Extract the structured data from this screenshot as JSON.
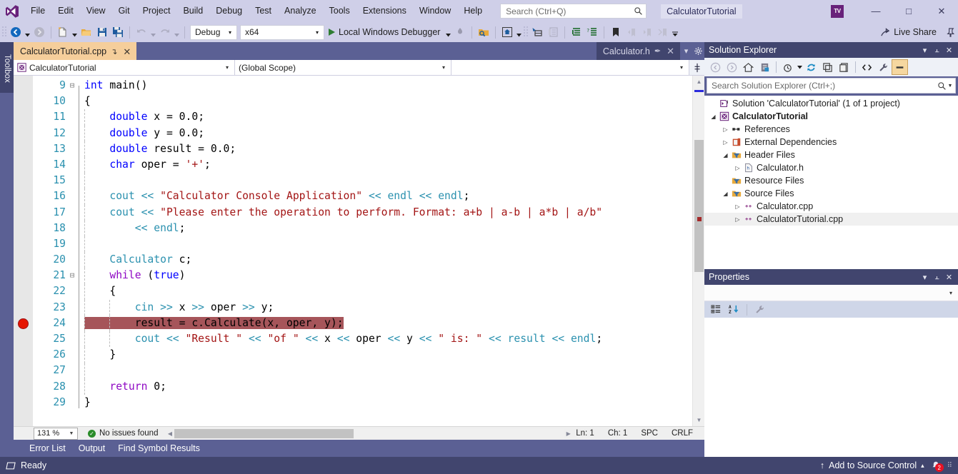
{
  "window": {
    "logo_icon": "visual-studio-logo",
    "project_chip": "CalculatorTutorial",
    "account_badge": "TV",
    "minimize": "—",
    "maximize": "□",
    "close": "✕"
  },
  "menu": {
    "items": [
      {
        "label": "File"
      },
      {
        "label": "Edit"
      },
      {
        "label": "View"
      },
      {
        "label": "Git"
      },
      {
        "label": "Project"
      },
      {
        "label": "Build"
      },
      {
        "label": "Debug"
      },
      {
        "label": "Test"
      },
      {
        "label": "Analyze"
      },
      {
        "label": "Tools"
      },
      {
        "label": "Extensions"
      },
      {
        "label": "Window"
      },
      {
        "label": "Help"
      }
    ]
  },
  "search": {
    "placeholder": "Search (Ctrl+Q)",
    "value": "",
    "icon": "search-icon"
  },
  "toolbar": {
    "navigate_back_icon": "navigate-back-icon",
    "navigate_forward_icon": "navigate-forward-icon",
    "new_item_icon": "new-item-icon",
    "open_file_icon": "open-file-icon",
    "save_icon": "save-icon",
    "save_all_icon": "save-all-icon",
    "undo_icon": "undo-icon",
    "redo_icon": "redo-icon",
    "config_combo": {
      "value": "Debug",
      "arrow": "▾"
    },
    "platform_combo": {
      "value": "x64",
      "arrow": "▾"
    },
    "run_label": "Local Windows Debugger",
    "run_arrow": "▾",
    "attach_icon": "attach-process-icon",
    "find_in_files_icon": "find-in-files-icon",
    "solution_explorer_icon": "solution-explorer-icon",
    "properties_window_icon": "properties-window-icon",
    "object_browser_icon": "object-browser-icon",
    "comment_icon": "comment-selection-icon",
    "uncomment_icon": "uncomment-selection-icon",
    "bookmark_icon": "bookmark-icon",
    "prev_bookmark_icon": "previous-bookmark-icon",
    "next_bookmark_icon": "next-bookmark-icon",
    "clear_bookmarks_icon": "clear-bookmarks-icon",
    "overflow_icon": "toolbar-overflow-icon",
    "live_share_label": "Live Share",
    "live_share_icon": "live-share-icon",
    "pin_icon": "pin-icon"
  },
  "toolbox": {
    "label": "Toolbox"
  },
  "editor": {
    "tabs": [
      {
        "label": "CalculatorTutorial.cpp",
        "active": true,
        "pin": "↴",
        "close": "✕"
      },
      {
        "label": "Calculator.h",
        "active": false,
        "pin": "✒",
        "close": "✕"
      }
    ],
    "tab_overflow_icon": "tab-overflow-icon",
    "tab_settings_icon": "tab-settings-icon",
    "nav_project": "CalculatorTutorial",
    "nav_project_icon": "cpp-project-icon",
    "nav_scope": "(Global Scope)",
    "nav_member": "",
    "split_icon": "split-view-icon",
    "zoom_level": "131 %",
    "issues_text": "No issues found",
    "issues_icon": "ok-check-icon",
    "line_status": "Ln: 1",
    "char_status": "Ch: 1",
    "spaces_status": "SPC",
    "eol_status": "CRLF",
    "breakpoint_line": 24,
    "code_lines": [
      {
        "n": 9,
        "glyph": "⊟",
        "tokens": [
          {
            "t": "int ",
            "c": "kw"
          },
          {
            "t": "main",
            "c": "op"
          },
          {
            "t": "()",
            "c": "op"
          }
        ],
        "indent": 0
      },
      {
        "n": 10,
        "glyph": "",
        "tokens": [
          {
            "t": "{",
            "c": "op"
          }
        ],
        "indent": 0
      },
      {
        "n": 11,
        "glyph": "",
        "tokens": [
          {
            "t": "    ",
            "c": "op"
          },
          {
            "t": "double",
            "c": "kw"
          },
          {
            "t": " x = ",
            "c": "op"
          },
          {
            "t": "0.0",
            "c": "op"
          },
          {
            "t": ";",
            "c": "op"
          }
        ],
        "indent": 1
      },
      {
        "n": 12,
        "glyph": "",
        "tokens": [
          {
            "t": "    ",
            "c": "op"
          },
          {
            "t": "double",
            "c": "kw"
          },
          {
            "t": " y = ",
            "c": "op"
          },
          {
            "t": "0.0",
            "c": "op"
          },
          {
            "t": ";",
            "c": "op"
          }
        ],
        "indent": 1
      },
      {
        "n": 13,
        "glyph": "",
        "tokens": [
          {
            "t": "    ",
            "c": "op"
          },
          {
            "t": "double",
            "c": "kw"
          },
          {
            "t": " result = ",
            "c": "op"
          },
          {
            "t": "0.0",
            "c": "op"
          },
          {
            "t": ";",
            "c": "op"
          }
        ],
        "indent": 1
      },
      {
        "n": 14,
        "glyph": "",
        "tokens": [
          {
            "t": "    ",
            "c": "op"
          },
          {
            "t": "char",
            "c": "kw"
          },
          {
            "t": " oper = ",
            "c": "op"
          },
          {
            "t": "'+'",
            "c": "str"
          },
          {
            "t": ";",
            "c": "op"
          }
        ],
        "indent": 1
      },
      {
        "n": 15,
        "glyph": "",
        "tokens": [],
        "indent": 1
      },
      {
        "n": 16,
        "glyph": "",
        "tokens": [
          {
            "t": "    ",
            "c": "op"
          },
          {
            "t": "cout",
            "c": "typ"
          },
          {
            "t": " ",
            "c": "op"
          },
          {
            "t": "<<",
            "c": "typ"
          },
          {
            "t": " ",
            "c": "op"
          },
          {
            "t": "\"Calculator Console Application\"",
            "c": "str"
          },
          {
            "t": " ",
            "c": "op"
          },
          {
            "t": "<<",
            "c": "typ"
          },
          {
            "t": " ",
            "c": "op"
          },
          {
            "t": "endl",
            "c": "typ"
          },
          {
            "t": " ",
            "c": "op"
          },
          {
            "t": "<<",
            "c": "typ"
          },
          {
            "t": " ",
            "c": "op"
          },
          {
            "t": "endl",
            "c": "typ"
          },
          {
            "t": ";",
            "c": "op"
          }
        ],
        "indent": 1
      },
      {
        "n": 17,
        "glyph": "",
        "tokens": [
          {
            "t": "    ",
            "c": "op"
          },
          {
            "t": "cout",
            "c": "typ"
          },
          {
            "t": " ",
            "c": "op"
          },
          {
            "t": "<<",
            "c": "typ"
          },
          {
            "t": " ",
            "c": "op"
          },
          {
            "t": "\"Please enter the operation to perform. Format: a+b | a-b | a*b | a/b\"",
            "c": "str"
          }
        ],
        "indent": 1
      },
      {
        "n": 18,
        "glyph": "",
        "tokens": [
          {
            "t": "        ",
            "c": "op"
          },
          {
            "t": "<<",
            "c": "typ"
          },
          {
            "t": " ",
            "c": "op"
          },
          {
            "t": "endl",
            "c": "typ"
          },
          {
            "t": ";",
            "c": "op"
          }
        ],
        "indent": 1
      },
      {
        "n": 19,
        "glyph": "",
        "tokens": [],
        "indent": 1
      },
      {
        "n": 20,
        "glyph": "",
        "tokens": [
          {
            "t": "    ",
            "c": "op"
          },
          {
            "t": "Calculator",
            "c": "typ"
          },
          {
            "t": " c;",
            "c": "op"
          }
        ],
        "indent": 1
      },
      {
        "n": 21,
        "glyph": "⊟",
        "tokens": [
          {
            "t": "    ",
            "c": "op"
          },
          {
            "t": "while",
            "c": "ctl"
          },
          {
            "t": " (",
            "c": "op"
          },
          {
            "t": "true",
            "c": "kw"
          },
          {
            "t": ")",
            "c": "op"
          }
        ],
        "indent": 1
      },
      {
        "n": 22,
        "glyph": "",
        "tokens": [
          {
            "t": "    {",
            "c": "op"
          }
        ],
        "indent": 1
      },
      {
        "n": 23,
        "glyph": "",
        "tokens": [
          {
            "t": "        ",
            "c": "op"
          },
          {
            "t": "cin",
            "c": "typ"
          },
          {
            "t": " ",
            "c": "op"
          },
          {
            "t": ">>",
            "c": "typ"
          },
          {
            "t": " x ",
            "c": "op"
          },
          {
            "t": ">>",
            "c": "typ"
          },
          {
            "t": " oper ",
            "c": "op"
          },
          {
            "t": ">>",
            "c": "typ"
          },
          {
            "t": " y;",
            "c": "op"
          }
        ],
        "indent": 2
      },
      {
        "n": 24,
        "glyph": "",
        "highlight": true,
        "tokens": [
          {
            "t": "        result = c.Calculate(x, oper, y);",
            "c": "op"
          }
        ],
        "indent": 2
      },
      {
        "n": 25,
        "glyph": "",
        "tokens": [
          {
            "t": "        ",
            "c": "op"
          },
          {
            "t": "cout",
            "c": "typ"
          },
          {
            "t": " ",
            "c": "op"
          },
          {
            "t": "<<",
            "c": "typ"
          },
          {
            "t": " ",
            "c": "op"
          },
          {
            "t": "\"Result \"",
            "c": "str"
          },
          {
            "t": " ",
            "c": "op"
          },
          {
            "t": "<<",
            "c": "typ"
          },
          {
            "t": " ",
            "c": "op"
          },
          {
            "t": "\"of \"",
            "c": "str"
          },
          {
            "t": " ",
            "c": "op"
          },
          {
            "t": "<<",
            "c": "typ"
          },
          {
            "t": " x ",
            "c": "op"
          },
          {
            "t": "<<",
            "c": "typ"
          },
          {
            "t": " oper ",
            "c": "op"
          },
          {
            "t": "<<",
            "c": "typ"
          },
          {
            "t": " y ",
            "c": "op"
          },
          {
            "t": "<<",
            "c": "typ"
          },
          {
            "t": " ",
            "c": "op"
          },
          {
            "t": "\" is: \"",
            "c": "str"
          },
          {
            "t": " ",
            "c": "op"
          },
          {
            "t": "<<",
            "c": "typ"
          },
          {
            "t": " ",
            "c": "op"
          },
          {
            "t": "result",
            "c": "typ"
          },
          {
            "t": " ",
            "c": "op"
          },
          {
            "t": "<<",
            "c": "typ"
          },
          {
            "t": " ",
            "c": "op"
          },
          {
            "t": "endl",
            "c": "typ"
          },
          {
            "t": ";",
            "c": "op"
          }
        ],
        "indent": 2
      },
      {
        "n": 26,
        "glyph": "",
        "tokens": [
          {
            "t": "    }",
            "c": "op"
          }
        ],
        "indent": 1
      },
      {
        "n": 27,
        "glyph": "",
        "tokens": [],
        "indent": 1
      },
      {
        "n": 28,
        "glyph": "",
        "tokens": [
          {
            "t": "    ",
            "c": "op"
          },
          {
            "t": "return",
            "c": "ctl"
          },
          {
            "t": " ",
            "c": "op"
          },
          {
            "t": "0",
            "c": "op"
          },
          {
            "t": ";",
            "c": "op"
          }
        ],
        "indent": 1
      },
      {
        "n": 29,
        "glyph": "",
        "tokens": [
          {
            "t": "}",
            "c": "op"
          }
        ],
        "indent": 0
      }
    ]
  },
  "dock": {
    "tabs": [
      {
        "label": "Error List"
      },
      {
        "label": "Output"
      },
      {
        "label": "Find Symbol Results"
      }
    ]
  },
  "solution_explorer": {
    "title": "Solution Explorer",
    "collapse_icon": "▾",
    "pin_icon": "⫠",
    "close_icon": "✕",
    "toolbar": {
      "back_icon": "back-icon",
      "forward_icon": "forward-icon",
      "home_icon": "home-icon",
      "pending_changes_icon": "pending-changes-icon",
      "view_options_icon": "view-options-icon",
      "refresh_icon": "refresh-icon",
      "collapse_all_icon": "collapse-all-icon",
      "show_all_files_icon": "show-all-files-icon",
      "view_code_icon": "view-code-icon",
      "properties_icon": "properties-wrench-icon",
      "preview_selected_icon": "preview-selected-items-icon"
    },
    "search_placeholder": "Search Solution Explorer (Ctrl+;)",
    "search_value": "",
    "search_icon": "search-icon",
    "tree": [
      {
        "label": "Solution 'CalculatorTutorial' (1 of 1 project)",
        "depth": 0,
        "twisty": "",
        "icon": "solution-icon",
        "bold": false,
        "selected": false
      },
      {
        "label": "CalculatorTutorial",
        "depth": 0,
        "twisty": "◢",
        "icon": "cpp-project-icon",
        "bold": true,
        "selected": false
      },
      {
        "label": "References",
        "depth": 1,
        "twisty": "▷",
        "icon": "references-icon",
        "bold": false,
        "selected": false
      },
      {
        "label": "External Dependencies",
        "depth": 1,
        "twisty": "▷",
        "icon": "external-dependencies-icon",
        "bold": false,
        "selected": false
      },
      {
        "label": "Header Files",
        "depth": 1,
        "twisty": "◢",
        "icon": "filter-folder-icon",
        "bold": false,
        "selected": false
      },
      {
        "label": "Calculator.h",
        "depth": 2,
        "twisty": "▷",
        "icon": "header-file-icon",
        "bold": false,
        "selected": false
      },
      {
        "label": "Resource Files",
        "depth": 1,
        "twisty": "",
        "icon": "filter-folder-icon",
        "bold": false,
        "selected": false
      },
      {
        "label": "Source Files",
        "depth": 1,
        "twisty": "◢",
        "icon": "filter-folder-icon",
        "bold": false,
        "selected": false
      },
      {
        "label": "Calculator.cpp",
        "depth": 2,
        "twisty": "▷",
        "icon": "cpp-file-icon",
        "bold": false,
        "selected": false
      },
      {
        "label": "CalculatorTutorial.cpp",
        "depth": 2,
        "twisty": "▷",
        "icon": "cpp-file-icon",
        "bold": false,
        "selected": true
      }
    ]
  },
  "properties": {
    "title": "Properties",
    "collapse_icon": "▾",
    "pin_icon": "⫠",
    "close_icon": "✕",
    "object_combo_arrow": "▾",
    "object_combo_value": "",
    "categorized_icon": "categorized-view-icon",
    "alphabetical_icon": "alphabetical-sort-icon",
    "property_pages_icon": "property-pages-icon"
  },
  "statusbar": {
    "ready_text": "Ready",
    "ready_icon": "status-ready-icon",
    "source_control_label": "Add to Source Control",
    "source_control_up_icon": "↑",
    "source_control_arrow": "▴",
    "notifications_icon": "bell-icon",
    "notifications_count": "2"
  },
  "colors": {
    "titlebar_bg": "#CFCFE8",
    "panel_header_bg": "#41456E",
    "dock_bg": "#5B6094",
    "statusbar_bg": "#41456E",
    "active_tab_bg": "#F5CE9B",
    "breakpoint_red": "#E51400",
    "highlight_line_bg": "#A6555A",
    "keyword_blue": "#0000FF",
    "control_purple": "#8F08C4",
    "string_red": "#A31515",
    "type_teal": "#2B91AF",
    "linenumber_teal": "#2B91AF"
  }
}
